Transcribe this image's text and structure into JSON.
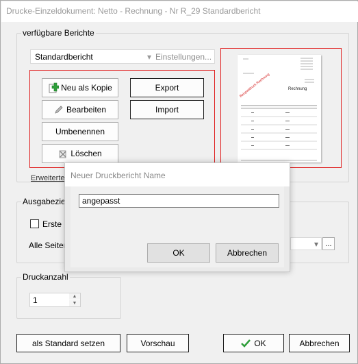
{
  "window": {
    "title": "Drucke-Einzeldokument: Netto - Rechnung - Nr R_29 Standardbericht"
  },
  "reports": {
    "group_label": "verfügbare Berichte",
    "selected_report": "Standardbericht",
    "settings_label": "Einstellungen...",
    "buttons": {
      "new_copy": "Neu als Kopie",
      "edit": "Bearbeiten",
      "rename": "Umbenennen",
      "delete": "Löschen",
      "export": "Export",
      "import": "Import"
    },
    "advanced_link": "Erweiterte",
    "preview": {
      "doc_title": "Rechnung",
      "watermark": "Beispieldruck Rechnung"
    }
  },
  "output": {
    "group_label": "Ausgabeziel",
    "first_page_label": "Erste S",
    "all_pages_label": "Alle Seiten:",
    "browse_label": "..."
  },
  "print_count": {
    "group_label": "Druckanzahl",
    "value": "1"
  },
  "footer": {
    "set_default": "als Standard setzen",
    "preview": "Vorschau",
    "ok": "OK",
    "cancel": "Abbrechen"
  },
  "dialog": {
    "title": "Neuer Druckbericht Name",
    "input_value": "angepasst",
    "ok": "OK",
    "cancel": "Abbrechen"
  },
  "colors": {
    "accent_red": "#e02020",
    "ok_check_green": "#2e9e3a"
  }
}
